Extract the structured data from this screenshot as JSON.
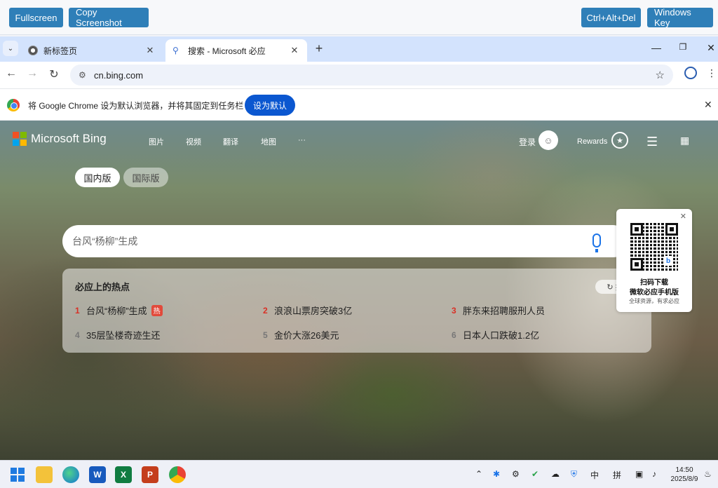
{
  "remote": {
    "fullscreen": "Fullscreen",
    "copy_screenshot": "Copy Screenshot",
    "ctrl_alt_del": "Ctrl+Alt+Del",
    "windows_key": "Windows Key"
  },
  "browser": {
    "tabs": [
      {
        "title": "新标签页",
        "active": false
      },
      {
        "title": "搜索 - Microsoft 必应",
        "active": true
      }
    ],
    "url": "cn.bing.com",
    "infobar": {
      "message": "将 Google Chrome 设为默认浏览器，并将其固定到任务栏",
      "button": "设为默认"
    }
  },
  "bing": {
    "logo_text": "Microsoft Bing",
    "nav": [
      "图片",
      "视频",
      "翻译",
      "地图",
      "···"
    ],
    "login": "登录",
    "rewards": "Rewards",
    "region_tabs": [
      "国内版",
      "国际版"
    ],
    "search_value": "台风“杨柳”生成",
    "hot": {
      "title": "必应上的热点",
      "swap": "换",
      "items": [
        {
          "rank": "1",
          "text": "台风“杨柳”生成",
          "badge": "热"
        },
        {
          "rank": "2",
          "text": "浪浪山票房突破3亿"
        },
        {
          "rank": "3",
          "text": "胖东来招聘服刑人员"
        },
        {
          "rank": "4",
          "text": "35层坠楼奇迹生还"
        },
        {
          "rank": "5",
          "text": "金价大涨26美元"
        },
        {
          "rank": "6",
          "text": "日本人口跌破1.2亿"
        }
      ]
    },
    "qr_card": {
      "line1": "扫码下载",
      "line2": "微软必应手机版",
      "line3": "全球资源，有求必应"
    }
  },
  "taskbar": {
    "tray_labels": [
      "中",
      "拼"
    ],
    "time": "14:50",
    "date": "2025/8/9"
  },
  "colors": {
    "accent_blue": "#2f7fb8",
    "chrome_blue": "#0b57d0",
    "hot_red": "#d93025"
  }
}
